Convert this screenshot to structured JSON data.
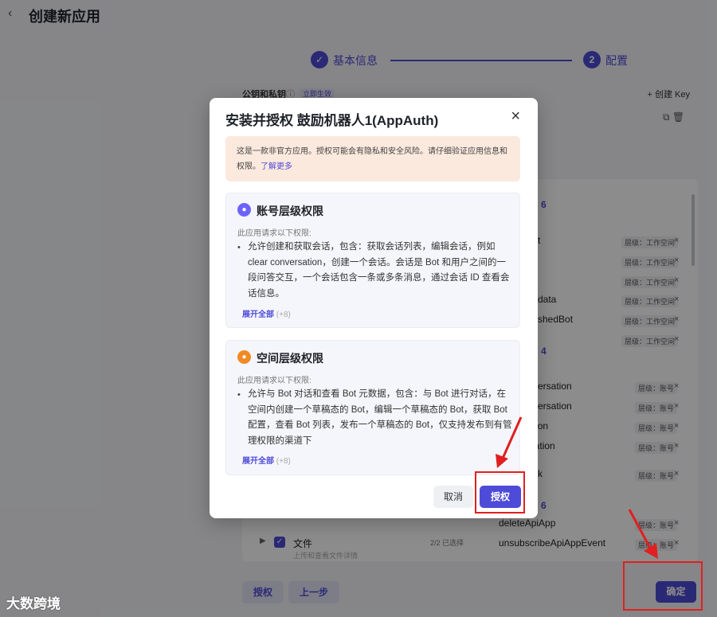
{
  "header": {
    "back_icon": "chevron-left-icon",
    "title": "创建新应用"
  },
  "steps": [
    {
      "index": "✓",
      "label": "基本信息"
    },
    {
      "index": "2",
      "label": "配置"
    }
  ],
  "keys": {
    "label": "公钥和私钥",
    "info_icon": "ⓘ",
    "badge": "立即生效",
    "create_label": "+ 创建 Key",
    "icons": "⧉ 🗑"
  },
  "perm_list": {
    "counts": [
      "6",
      "4",
      "6"
    ],
    "rows": [
      {
        "name": "t",
        "tag": "层级：工作空间"
      },
      {
        "name": "",
        "tag": "层级：工作空间"
      },
      {
        "name": "",
        "tag": "层级：工作空间"
      },
      {
        "name": "data",
        "tag": "层级：工作空间"
      },
      {
        "name": "shedBot",
        "tag": "层级：工作空间"
      },
      {
        "name": "",
        "tag": "层级：工作空间"
      },
      {
        "name": "ersation",
        "tag": "层级：账号"
      },
      {
        "name": "ersation",
        "tag": "层级：账号"
      },
      {
        "name": "onversation",
        "tag": "层级：账号"
      },
      {
        "name": "Conversation",
        "tag": "层级：账号"
      },
      {
        "name": "k",
        "tag": "层级：账号"
      },
      {
        "name": "deleteApiApp",
        "tag": "层级：账号"
      },
      {
        "name": "unsubscribeApiAppEvent",
        "tag": "层级：账号"
      }
    ]
  },
  "file_row": {
    "name": "文件",
    "sub": "上传和查看文件详情",
    "count": "2/2 已选择"
  },
  "footer": {
    "auth_label": "授权",
    "prev_label": "上一步",
    "confirm_label": "确定"
  },
  "modal": {
    "title": "安装并授权 鼓励机器人1(AppAuth)",
    "warning": "这是一款非官方应用。授权可能会有隐私和安全风险。请仔细验证应用信息和权限。",
    "learn_more": "了解更多",
    "cards": [
      {
        "title": "账号层级权限",
        "subtitle": "此应用请求以下权限:",
        "text": "允许创建和获取会话，包含：获取会话列表，编辑会话，例如 clear conversation，创建一个会话。会话是 Bot 和用户之间的一段问答交互，一个会话包含一条或多条消息，通过会话 ID 查看会话信息。",
        "more": "展开全部",
        "more_count": "(+8)"
      },
      {
        "title": "空间层级权限",
        "subtitle": "此应用请求以下权限:",
        "text": "允许与 Bot 对话和查看 Bot 元数据，包含：与 Bot 进行对话，在空间内创建一个草稿态的 Bot，编辑一个草稿态的 Bot，获取 Bot 配置，查看 Bot 列表，发布一个草稿态的 Bot，仅支持发布到有管理权限的渠道下",
        "more": "展开全部",
        "more_count": "(+8)"
      }
    ],
    "cancel_label": "取消",
    "authorize_label": "授权"
  },
  "watermark": "大数跨境",
  "colors": {
    "accent": "#4e4bd8",
    "warning_bg": "#fbe9de",
    "annotation": "#e02020",
    "account_icon": "#6c63ff",
    "space_icon": "#f08a24"
  }
}
